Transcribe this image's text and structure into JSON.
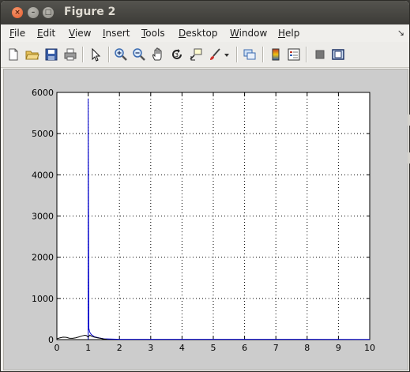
{
  "window": {
    "title": "Figure 2",
    "close_glyph": "×",
    "min_glyph": "–",
    "max_glyph": "□"
  },
  "menu": {
    "items": [
      {
        "name": "file",
        "first": "F",
        "rest": "ile"
      },
      {
        "name": "edit",
        "first": "E",
        "rest": "dit"
      },
      {
        "name": "view",
        "first": "V",
        "rest": "iew"
      },
      {
        "name": "insert",
        "first": "I",
        "rest": "nsert"
      },
      {
        "name": "tools",
        "first": "T",
        "rest": "ools"
      },
      {
        "name": "desktop",
        "first": "D",
        "rest": "esktop"
      },
      {
        "name": "window",
        "first": "W",
        "rest": "indow"
      },
      {
        "name": "help",
        "first": "H",
        "rest": "elp"
      }
    ],
    "dock_arrow": "↘"
  },
  "toolbar": {
    "icons": [
      "new-figure-icon",
      "open-file-icon",
      "save-figure-icon",
      "print-figure-icon",
      "edit-plot-arrow-icon",
      "zoom-in-icon",
      "zoom-out-icon",
      "pan-hand-icon",
      "rotate-3d-icon",
      "data-cursor-icon",
      "brush-icon",
      "brush-dropdown-icon",
      "link-plot-icon",
      "colorbar-icon",
      "legend-icon",
      "hide-plot-tools-icon",
      "show-plot-tools-icon"
    ]
  },
  "chart_data": {
    "type": "line",
    "title": "",
    "xlabel": "",
    "ylabel": "",
    "xlim": [
      0,
      10
    ],
    "ylim": [
      0,
      6000
    ],
    "xticks": [
      "0",
      "1",
      "2",
      "3",
      "4",
      "5",
      "6",
      "7",
      "8",
      "9",
      "10"
    ],
    "yticks": [
      "0",
      "1000",
      "2000",
      "3000",
      "4000",
      "5000",
      "6000"
    ],
    "grid": true,
    "series": [
      {
        "color": "#0000cc",
        "x": [
          1.0,
          1.0,
          1.02,
          1.05,
          1.1,
          1.2,
          1.35,
          1.5,
          2.0,
          10.0
        ],
        "y": [
          0,
          5850,
          280,
          180,
          120,
          70,
          40,
          20,
          8,
          5
        ]
      },
      {
        "color": "#000000",
        "x": [
          0,
          0.1,
          0.2,
          0.3,
          0.4,
          0.5,
          0.6,
          0.7,
          0.8,
          0.9,
          0.95,
          1.0,
          1.05,
          1.1,
          1.2,
          1.3,
          1.4,
          1.5,
          1.6
        ],
        "y": [
          20,
          45,
          60,
          55,
          35,
          30,
          45,
          65,
          90,
          105,
          95,
          60,
          110,
          85,
          60,
          45,
          30,
          15,
          5
        ]
      }
    ]
  }
}
